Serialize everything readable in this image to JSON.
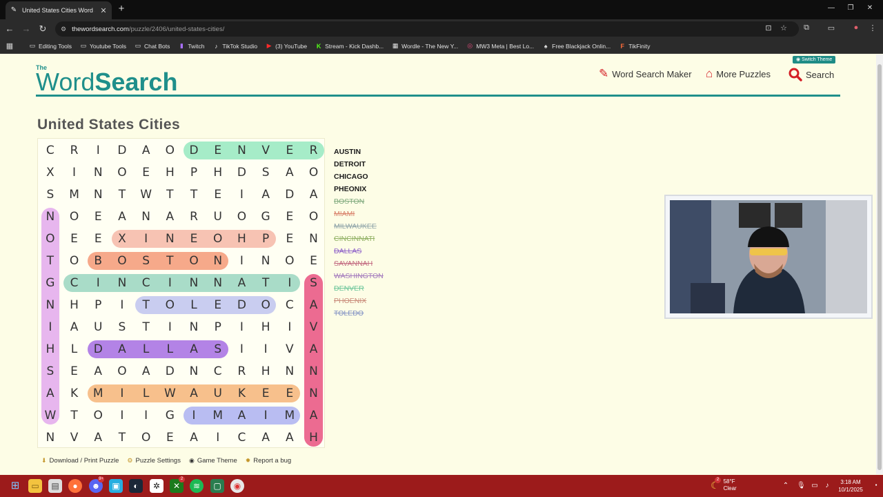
{
  "browser": {
    "tab_title": "United States Cities Word Search",
    "new_tab": "+",
    "url_domain": "thewordsearch.com",
    "url_path": "/puzzle/2406/united-states-cities/",
    "bookmarks": [
      {
        "label": "Editing Tools",
        "icon": "folder-icon"
      },
      {
        "label": "Youtube Tools",
        "icon": "folder-icon"
      },
      {
        "label": "Chat Bots",
        "icon": "folder-icon"
      },
      {
        "label": "Twitch",
        "icon": "twitch-icon"
      },
      {
        "label": "TikTok Studio",
        "icon": "tiktok-icon"
      },
      {
        "label": "(3) YouTube",
        "icon": "youtube-icon"
      },
      {
        "label": "Stream - Kick Dashb...",
        "icon": "kick-icon"
      },
      {
        "label": "Wordle - The New Y...",
        "icon": "wordle-icon"
      },
      {
        "label": "MW3 Meta | Best Lo...",
        "icon": "target-icon"
      },
      {
        "label": "Free Blackjack Onlin...",
        "icon": "blackjack-icon"
      },
      {
        "label": "TikFinity",
        "icon": "tikfinity-icon"
      }
    ]
  },
  "header": {
    "logo_small": "The",
    "logo_word": "Word",
    "logo_search": "Search",
    "switch_theme": "Switch Theme",
    "nav": {
      "maker": "Word Search Maker",
      "more": "More Puzzles",
      "search": "Search"
    }
  },
  "puzzle": {
    "title": "United States Cities",
    "grid": [
      [
        "C",
        "R",
        "I",
        "D",
        "A",
        "O",
        "D",
        "E",
        "N",
        "V",
        "E",
        "R"
      ],
      [
        "X",
        "I",
        "N",
        "O",
        "E",
        "H",
        "P",
        "H",
        "D",
        "S",
        "A",
        "O"
      ],
      [
        "S",
        "M",
        "N",
        "T",
        "W",
        "T",
        "T",
        "E",
        "I",
        "A",
        "D",
        "A"
      ],
      [
        "N",
        "O",
        "E",
        "A",
        "N",
        "A",
        "R",
        "U",
        "O",
        "G",
        "E",
        "O"
      ],
      [
        "O",
        "E",
        "E",
        "X",
        "I",
        "N",
        "E",
        "O",
        "H",
        "P",
        "E",
        "N"
      ],
      [
        "T",
        "O",
        "B",
        "O",
        "S",
        "T",
        "O",
        "N",
        "I",
        "N",
        "O",
        "E"
      ],
      [
        "G",
        "C",
        "I",
        "N",
        "C",
        "I",
        "N",
        "N",
        "A",
        "T",
        "I",
        "S"
      ],
      [
        "N",
        "H",
        "P",
        "I",
        "T",
        "O",
        "L",
        "E",
        "D",
        "O",
        "C",
        "A"
      ],
      [
        "I",
        "A",
        "U",
        "S",
        "T",
        "I",
        "N",
        "P",
        "I",
        "H",
        "I",
        "V"
      ],
      [
        "H",
        "L",
        "D",
        "A",
        "L",
        "L",
        "A",
        "S",
        "I",
        "I",
        "V",
        "A"
      ],
      [
        "S",
        "E",
        "A",
        "O",
        "A",
        "D",
        "N",
        "C",
        "R",
        "H",
        "N",
        "N"
      ],
      [
        "A",
        "K",
        "M",
        "I",
        "L",
        "W",
        "A",
        "U",
        "K",
        "E",
        "E",
        "N"
      ],
      [
        "W",
        "T",
        "O",
        "I",
        "I",
        "G",
        "I",
        "M",
        "A",
        "I",
        "M",
        "A"
      ],
      [
        "N",
        "V",
        "A",
        "T",
        "O",
        "E",
        "A",
        "I",
        "C",
        "A",
        "A",
        "H"
      ]
    ],
    "highlights": [
      {
        "word": "DENVER",
        "row": 0,
        "col": 6,
        "dir": "h",
        "len": 6,
        "color": "#a6ecc8"
      },
      {
        "word": "PHOENIX",
        "row": 4,
        "col": 3,
        "dir": "h",
        "len": 7,
        "color": "#f7c3b3"
      },
      {
        "word": "BOSTON",
        "row": 5,
        "col": 2,
        "dir": "h",
        "len": 6,
        "color": "#f6a98a"
      },
      {
        "word": "CINCINNATI",
        "row": 6,
        "col": 1,
        "dir": "h",
        "len": 10,
        "color": "#a9dcc8"
      },
      {
        "word": "TOLEDO",
        "row": 7,
        "col": 4,
        "dir": "h",
        "len": 6,
        "color": "#c9cdf0"
      },
      {
        "word": "DALLAS",
        "row": 9,
        "col": 2,
        "dir": "h",
        "len": 6,
        "color": "#b383e6"
      },
      {
        "word": "MILWAUKEE",
        "row": 11,
        "col": 2,
        "dir": "h",
        "len": 9,
        "color": "#f7c08c"
      },
      {
        "word": "MIAMI",
        "row": 12,
        "col": 6,
        "dir": "h",
        "len": 5,
        "color": "#b9bdf2"
      },
      {
        "word": "WASHINGTON",
        "row": 3,
        "col": 0,
        "dir": "v",
        "len": 10,
        "color": "#e7b6ee"
      },
      {
        "word": "SAVANNAH",
        "row": 6,
        "col": 11,
        "dir": "v",
        "len": 8,
        "color": "#ec6b91"
      }
    ],
    "words": [
      {
        "text": "AUSTIN",
        "found": false,
        "color": "#1a1a1a"
      },
      {
        "text": "DETROIT",
        "found": false,
        "color": "#1a1a1a"
      },
      {
        "text": "CHICAGO",
        "found": false,
        "color": "#1a1a1a"
      },
      {
        "text": "PHEONIX",
        "found": false,
        "color": "#1a1a1a"
      },
      {
        "text": "BOSTON",
        "found": true,
        "color": "#7fa97d"
      },
      {
        "text": "MIAMI",
        "found": true,
        "color": "#d9826b"
      },
      {
        "text": "MILWAUKEE",
        "found": true,
        "color": "#8ea3a8"
      },
      {
        "text": "CINCINNATI",
        "found": true,
        "color": "#90b063"
      },
      {
        "text": "DALLAS",
        "found": true,
        "color": "#8c5fc8"
      },
      {
        "text": "SAVANNAH",
        "found": true,
        "color": "#c26a80"
      },
      {
        "text": "WASHINGTON",
        "found": true,
        "color": "#a47bbd"
      },
      {
        "text": "DENVER",
        "found": true,
        "color": "#6cc59a"
      },
      {
        "text": "PHOENIX",
        "found": true,
        "color": "#c98b7a"
      },
      {
        "text": "TOLEDO",
        "found": true,
        "color": "#8191c4"
      }
    ],
    "footer": {
      "download": "Download / Print Puzzle",
      "settings": "Puzzle Settings",
      "theme": "Game Theme",
      "bug": "Report a bug"
    }
  },
  "taskbar": {
    "weather_temp": "58°F",
    "weather_cond": "Clear",
    "weather_badge": "2",
    "discord_badge": "9+",
    "copilot_badge": "2",
    "time": "3:18 AM",
    "date": "10/1/2025"
  }
}
